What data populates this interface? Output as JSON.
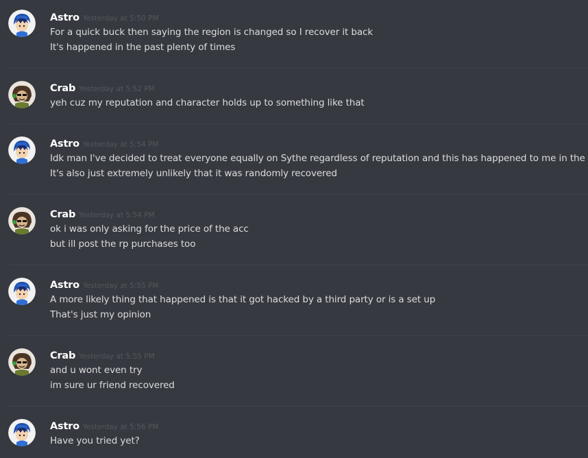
{
  "colors": {
    "background": "#36393f",
    "username": "#ffffff",
    "timestamp": "#54575d",
    "message_text": "#dcddde",
    "divider": "#3f4248"
  },
  "messages": [
    {
      "author": "Astro",
      "avatar_icon": "astro-avatar-icon",
      "timestamp": "Yesterday at 5:50 PM",
      "lines": [
        "For a quick buck then saying the region is changed so I recover it back",
        "It's happened in the past plenty of times"
      ]
    },
    {
      "author": "Crab",
      "avatar_icon": "crab-avatar-icon",
      "timestamp": "Yesterday at 5:52 PM",
      "lines": [
        "yeh cuz my reputation and character holds up to something like that"
      ]
    },
    {
      "author": "Astro",
      "avatar_icon": "astro-avatar-icon",
      "timestamp": "Yesterday at 5:54 PM",
      "lines": [
        "Idk man I've decided to treat everyone equally on Sythe regardless of reputation and this has happened to me in the past",
        "It's also just extremely unlikely that it was randomly recovered"
      ]
    },
    {
      "author": "Crab",
      "avatar_icon": "crab-avatar-icon",
      "timestamp": "Yesterday at 5:54 PM",
      "lines": [
        "ok i was only asking for the price of the acc",
        "but ill post the rp purchases too"
      ]
    },
    {
      "author": "Astro",
      "avatar_icon": "astro-avatar-icon",
      "timestamp": "Yesterday at 5:55 PM",
      "lines": [
        "A more likely thing that happened is that it got hacked by a third party or is a set up",
        "That's just my opinion"
      ]
    },
    {
      "author": "Crab",
      "avatar_icon": "crab-avatar-icon",
      "timestamp": "Yesterday at 5:55 PM",
      "lines": [
        "and u wont even try",
        "im sure ur friend recovered"
      ]
    },
    {
      "author": "Astro",
      "avatar_icon": "astro-avatar-icon",
      "timestamp": "Yesterday at 5:56 PM",
      "lines": [
        "Have you tried yet?"
      ]
    }
  ]
}
